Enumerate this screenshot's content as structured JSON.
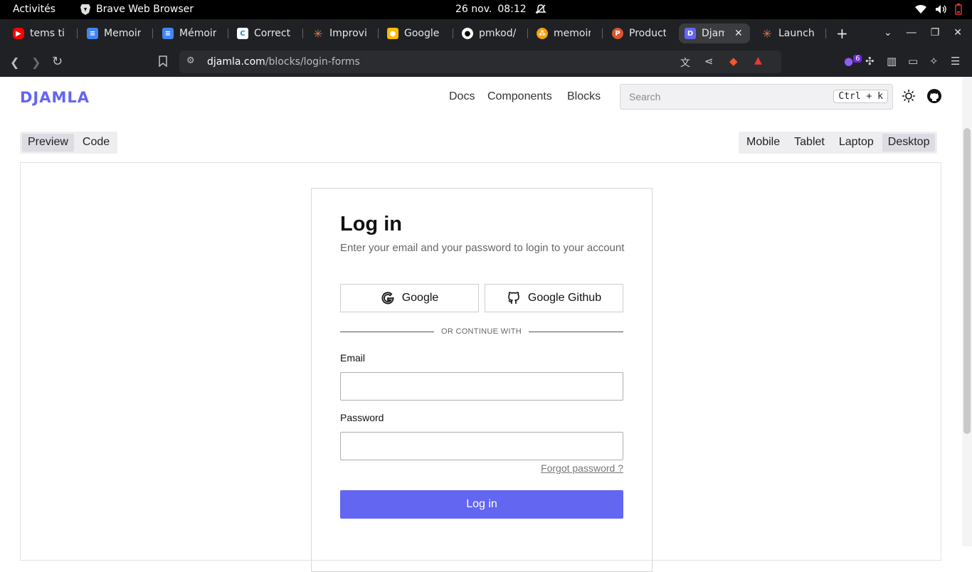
{
  "system_bar": {
    "activities": "Activités",
    "app_name": "Brave Web Browser",
    "date": "26 nov.",
    "time": "08:12"
  },
  "tabs": [
    {
      "label": "tems tia",
      "favicon": "youtube-icon",
      "color": "#ff0000"
    },
    {
      "label": "Memoire",
      "favicon": "docs-icon",
      "color": "#4285f4"
    },
    {
      "label": "Mémoire",
      "favicon": "docs-icon",
      "color": "#4285f4"
    },
    {
      "label": "Correcte",
      "favicon": "corrector-icon",
      "color": "#ffffff"
    },
    {
      "label": "Improvin",
      "favicon": "claude-icon",
      "color": "#d97757"
    },
    {
      "label": "Google I",
      "favicon": "keep-icon",
      "color": "#fbbc04"
    },
    {
      "label": "pmkod/",
      "favicon": "github-icon",
      "color": "#ffffff"
    },
    {
      "label": "memoire",
      "favicon": "overleaf-icon",
      "color": "#f59e0b"
    },
    {
      "label": "Product",
      "favicon": "producthunt-icon",
      "color": "#da552f"
    },
    {
      "label": "Djam",
      "favicon": "djamla-icon",
      "color": "#6366f1"
    },
    {
      "label": "Launchi",
      "favicon": "claude-icon",
      "color": "#d97757"
    }
  ],
  "address_bar": {
    "domain": "djamla.com",
    "path": "/blocks/login-forms",
    "extension_badge": "6"
  },
  "site": {
    "logo": "DJAMLA",
    "nav": [
      "Docs",
      "Components",
      "Blocks"
    ],
    "search_placeholder": "Search",
    "search_shortcut": "Ctrl + k"
  },
  "view_tabs": {
    "left": [
      "Preview",
      "Code"
    ],
    "left_selected": "Preview",
    "right": [
      "Mobile",
      "Tablet",
      "Laptop",
      "Desktop"
    ],
    "right_selected": "Desktop"
  },
  "login": {
    "title": "Log in",
    "subtitle": "Enter your email and your password to login to your account",
    "google_label": "Google",
    "github_label": "Google Github",
    "divider": "OR CONTINUE WITH",
    "email_label": "Email",
    "email_value": "",
    "password_label": "Password",
    "password_value": "",
    "forgot": "Forgot password ?",
    "submit": "Log in",
    "accent": "#6366f1"
  }
}
